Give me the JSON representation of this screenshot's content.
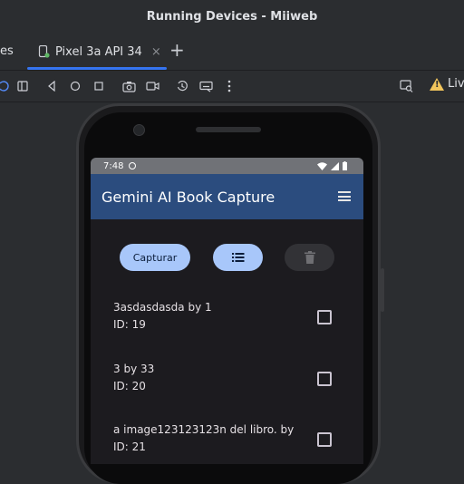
{
  "window": {
    "title": "Running Devices - Miiweb"
  },
  "tabs": {
    "previous_tab_fragment": "es",
    "active_tab": "Pixel 3a API 34",
    "close_symbol": "×",
    "add_symbol": "+"
  },
  "toolbar": {
    "icons": [
      "rotate-icon",
      "fold-icon",
      "back-icon",
      "home-icon",
      "overview-icon",
      "screenshot-icon",
      "screen-record-icon",
      "restore-icon",
      "keyboard-icon",
      "more-icon",
      "device-mirror-icon",
      "warning-icon"
    ],
    "live_label": "Live"
  },
  "device": {
    "status_time": "7:48",
    "app_title": "Gemini AI Book Capture",
    "buttons": {
      "capture_label": "Capturar"
    },
    "colors": {
      "app_bar": "#2b4c7e",
      "primary_button": "#a8c7fa",
      "disabled_button": "#323236"
    },
    "items": [
      {
        "title": "3asdasdasda by 1",
        "id": "ID: 19"
      },
      {
        "title": "3 by 33",
        "id": "ID: 20"
      },
      {
        "title": "a image123123123n del libro.  by",
        "id": "ID: 21"
      }
    ]
  }
}
